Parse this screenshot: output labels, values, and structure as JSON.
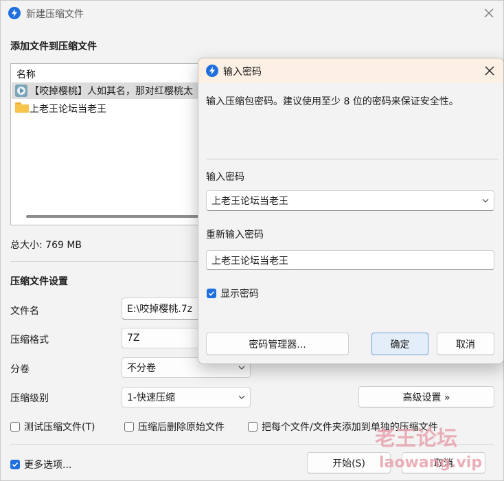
{
  "main_window": {
    "title": "新建压缩文件",
    "add_section_title": "添加文件到压缩文件",
    "file_list": {
      "column_name": "名称",
      "items": [
        {
          "name": "【咬掉樱桃】人如其名，那对红樱桃太",
          "icon": "video-file-icon"
        },
        {
          "name": "上老王论坛当老王",
          "icon": "folder-icon"
        }
      ]
    },
    "total_size_label": "总大小: 769 MB",
    "settings_title": "压缩文件设置",
    "filename_label": "文件名",
    "filename_value": "E:\\咬掉樱桃.7z",
    "format_label": "压缩格式",
    "format_value": "7Z",
    "volume_label": "分卷",
    "volume_value": "不分卷",
    "level_label": "压缩级别",
    "level_value": "1-快速压缩",
    "advanced_button": "高级设置 »",
    "test_archive": "测试压缩文件(T)",
    "delete_after": "压缩后删除原始文件",
    "each_separately": "把每个文件/文件夹添加到单独的压缩文件",
    "more_options": "更多选项...",
    "start_button": "开始(S)",
    "cancel_button": "取消"
  },
  "dialog": {
    "title": "输入密码",
    "description": "输入压缩包密码。建议使用至少 8 位的密码来保证安全性。",
    "password_label": "输入密码",
    "password_value": "上老王论坛当老王",
    "reenter_label": "重新输入密码",
    "reenter_value": "上老王论坛当老王",
    "show_password": "显示密码",
    "manager_button": "密码管理器...",
    "ok_button": "确定",
    "cancel_button": "取消"
  },
  "watermark": {
    "text": "老王论坛",
    "url": "laowang.vip"
  },
  "colors": {
    "accent": "#1f6fde",
    "dialog_titlebar": "#fcefe3",
    "window_bg": "#f3f3f3"
  }
}
